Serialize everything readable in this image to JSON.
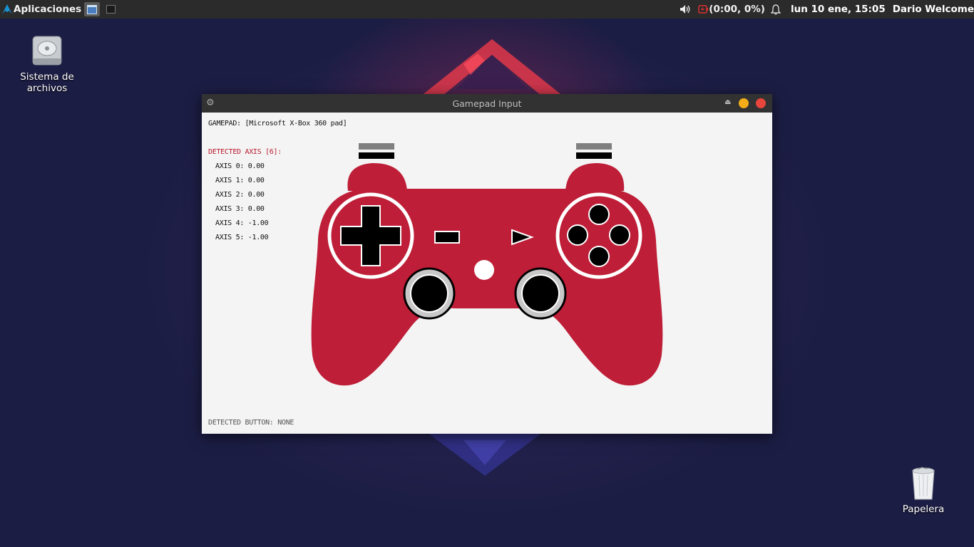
{
  "panel": {
    "apps_label": "Aplicaciones",
    "battery": "(0:00, 0%)",
    "clock": "lun 10 ene, 15:05",
    "user": "Dario Welcome"
  },
  "desktop": {
    "filesystem_label_1": "Sistema de",
    "filesystem_label_2": "archivos",
    "trash_label": "Papelera"
  },
  "window": {
    "title": "Gamepad Input",
    "gamepad_label": "GAMEPAD: [Microsoft X-Box 360 pad]",
    "axis_header": "DETECTED AXIS [6]:",
    "axes": [
      "AXIS 0: 0.00",
      "AXIS 1: 0.00",
      "AXIS 2: 0.00",
      "AXIS 3: 0.00",
      "AXIS 4: -1.00",
      "AXIS 5: -1.00"
    ],
    "button_label": "DETECTED BUTTON: NONE"
  },
  "colors": {
    "pad_red": "#be1e37",
    "panel_bg": "#2b2b2b",
    "titlebar_bg": "#323232",
    "close": "#e8453c",
    "minimize": "#f4ac19"
  },
  "icons": [
    "arch-logo-icon",
    "window-icon",
    "terminal-icon",
    "volume-icon",
    "battery-icon",
    "bell-icon",
    "gear-icon",
    "eject-icon",
    "minimize-icon",
    "close-icon",
    "drive-icon",
    "trash-icon"
  ]
}
